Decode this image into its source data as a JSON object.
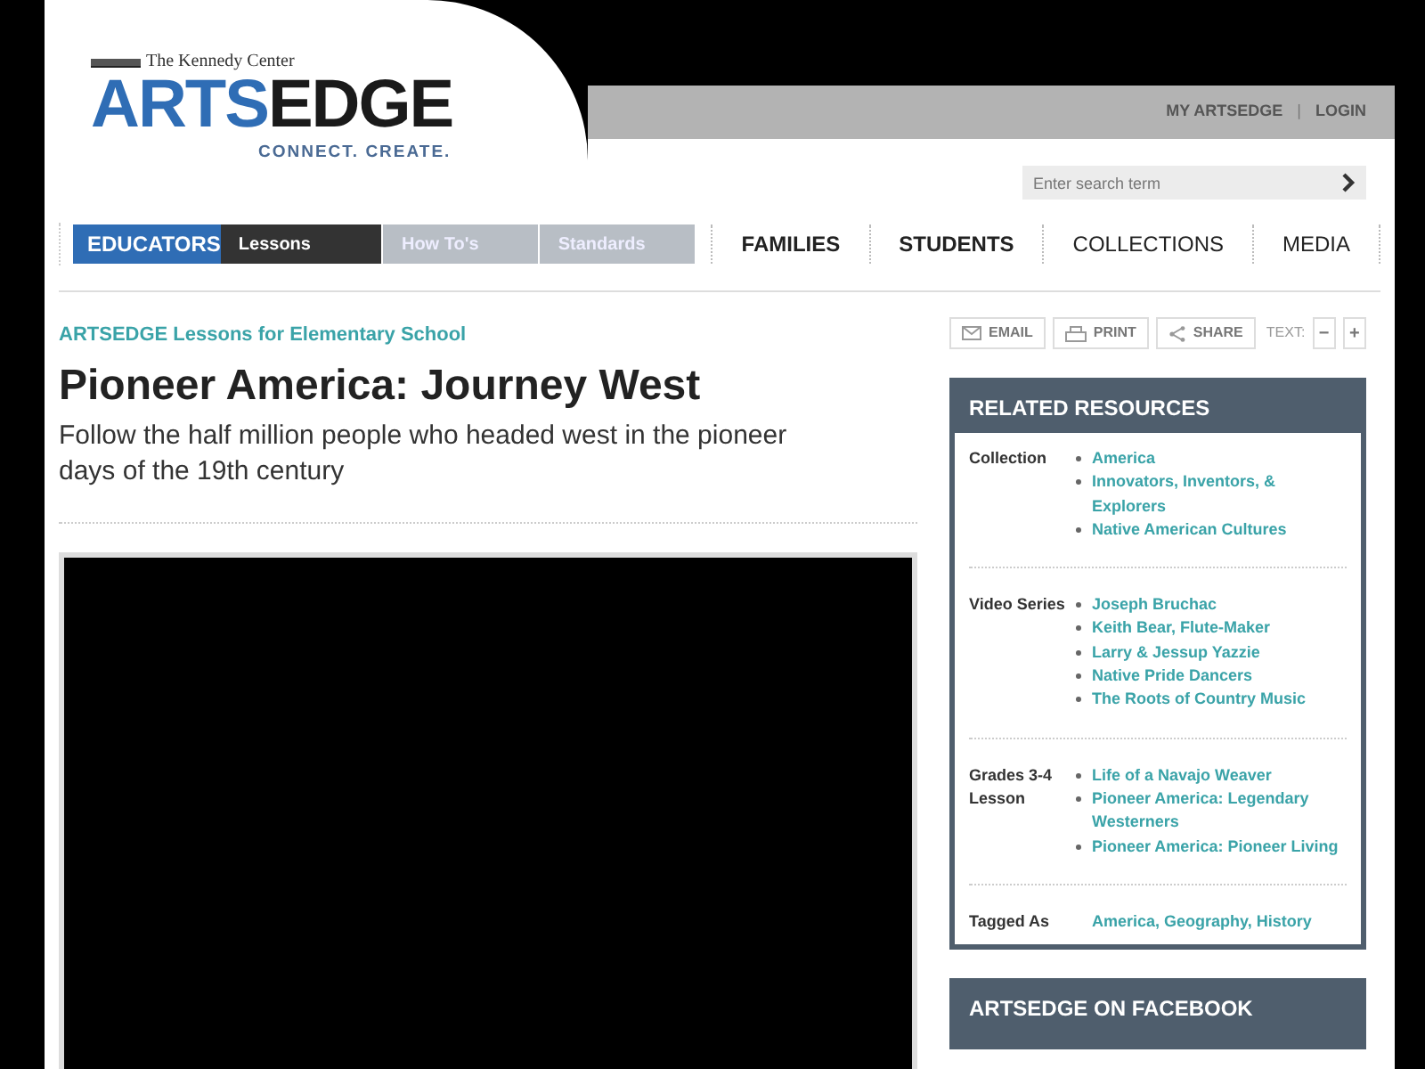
{
  "header": {
    "logo": {
      "org": "The Kennedy Center",
      "word_a": "ARTS",
      "word_b": "EDGE",
      "tagline": "CONNECT. CREATE."
    },
    "top_links": [
      "MY ARTSEDGE",
      "|",
      "LOGIN"
    ],
    "search": {
      "placeholder": "Enter search term"
    }
  },
  "nav": {
    "section": "EDUCATORS",
    "subnav": [
      {
        "label": "Lessons",
        "selected": true
      },
      {
        "label": "How To's",
        "selected": false
      },
      {
        "label": "Standards",
        "selected": false
      }
    ],
    "main": [
      {
        "label": "FAMILIES",
        "bold": true
      },
      {
        "label": "STUDENTS",
        "bold": true
      },
      {
        "label": "COLLECTIONS",
        "bold": false
      },
      {
        "label": "MEDIA",
        "bold": false
      }
    ]
  },
  "article": {
    "breadcrumb": "ARTSEDGE Lessons for Elementary School",
    "title": "Pioneer America: Journey West",
    "subtitle": "Follow the half million people who headed west in the pioneer days of the 19th century",
    "media": {
      "kind": "video"
    }
  },
  "tools": {
    "buttons": [
      {
        "kind": "email",
        "label": "EMAIL"
      },
      {
        "kind": "print",
        "label": "PRINT"
      },
      {
        "kind": "share",
        "label": "SHARE"
      }
    ],
    "text_label": "TEXT:",
    "size_buttons": [
      "−",
      "+"
    ]
  },
  "related": {
    "title": "RELATED RESOURCES",
    "groups": [
      {
        "label": "Collection",
        "items": [
          "America",
          "Innovators, Inventors, & Explorers",
          "Native American Cultures"
        ]
      },
      {
        "label": "Video Series",
        "items": [
          "Joseph Bruchac",
          "Keith Bear, Flute-Maker",
          "Larry & Jessup Yazzie",
          "Native Pride Dancers",
          "The Roots of Country Music"
        ]
      },
      {
        "label": "Grades 3-4 Lesson",
        "items": [
          "Life of a Navajo Weaver",
          "Pioneer America: Legendary Westerners",
          "Pioneer America: Pioneer Living"
        ]
      }
    ],
    "tagged": {
      "label": "Tagged As",
      "value": "America, Geography, History"
    }
  },
  "facebook": {
    "title": "ARTSEDGE ON FACEBOOK"
  }
}
